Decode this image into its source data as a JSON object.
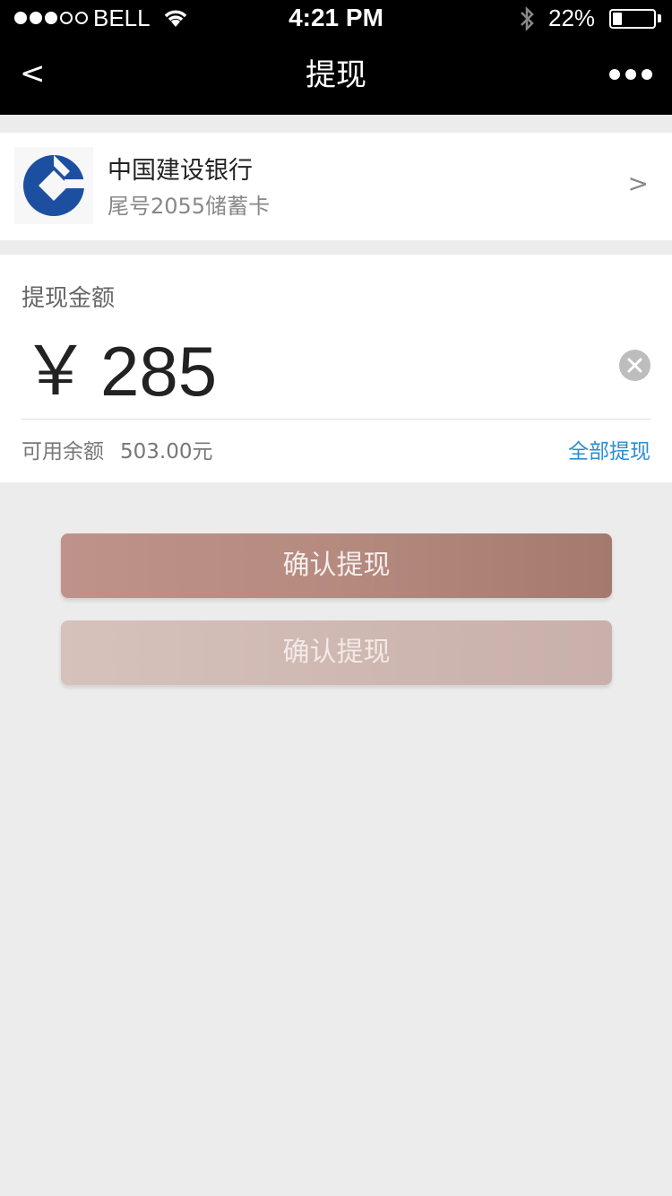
{
  "status_bar": {
    "carrier": "BELL",
    "time": "4:21 PM",
    "battery_percent": "22%",
    "battery_level": 0.22,
    "signal_bars_filled": 3,
    "signal_bars_total": 5
  },
  "nav": {
    "back_label": "<",
    "title": "提现"
  },
  "bank": {
    "name": "中国建设银行",
    "card_desc": "尾号2055储蓄卡",
    "chevron": ">",
    "logo_color": "#1d4fa0"
  },
  "amount": {
    "label": "提现金额",
    "currency_symbol": "￥",
    "value": "285",
    "balance_label": "可用余额",
    "balance_value": "503.00元",
    "withdraw_all_label": "全部提现"
  },
  "buttons": {
    "confirm_label": "确认提现",
    "confirm_disabled_label": "确认提现"
  },
  "colors": {
    "accent_link": "#2a8fd2",
    "primary_button": "#b58a7f",
    "background": "#ececec"
  }
}
